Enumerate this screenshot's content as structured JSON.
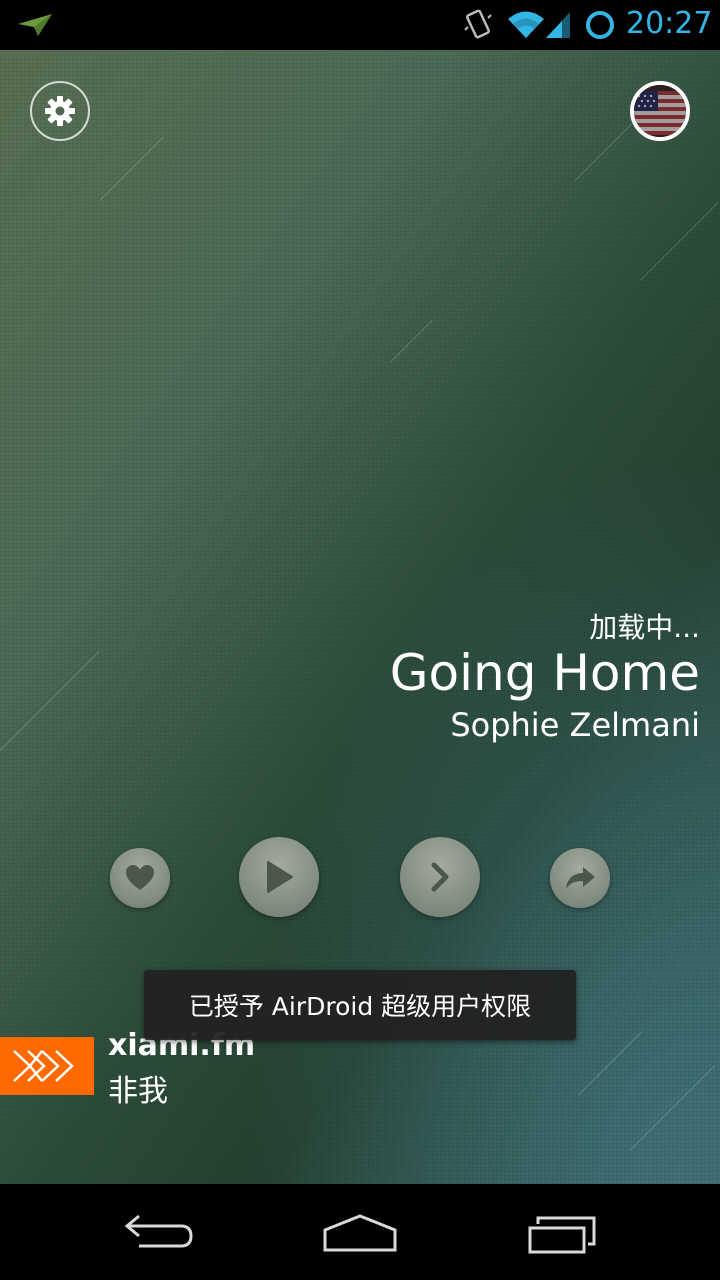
{
  "status_bar": {
    "time": "20:27",
    "icons": [
      "airdroid-notification-icon",
      "vibrate-icon",
      "wifi-icon",
      "signal-icon",
      "sync-icon"
    ],
    "accent_color": "#33b5e5"
  },
  "header": {
    "settings_icon": "gear-icon",
    "avatar_icon": "us-flag-avatar"
  },
  "now_playing": {
    "status": "加载中...",
    "title": "Going Home",
    "artist": "Sophie Zelmani"
  },
  "controls": [
    {
      "name": "like",
      "icon": "heart-icon"
    },
    {
      "name": "play",
      "icon": "play-icon"
    },
    {
      "name": "next",
      "icon": "chevron-right-icon"
    },
    {
      "name": "share",
      "icon": "share-arrow-icon"
    }
  ],
  "brand": {
    "name": "xiami.fm",
    "channel": "非我",
    "color": "#ff6a00"
  },
  "toast": {
    "message": "已授予 AirDroid 超级用户权限"
  },
  "nav_bar": {
    "icons": [
      "back-icon",
      "home-icon",
      "recents-icon"
    ]
  }
}
